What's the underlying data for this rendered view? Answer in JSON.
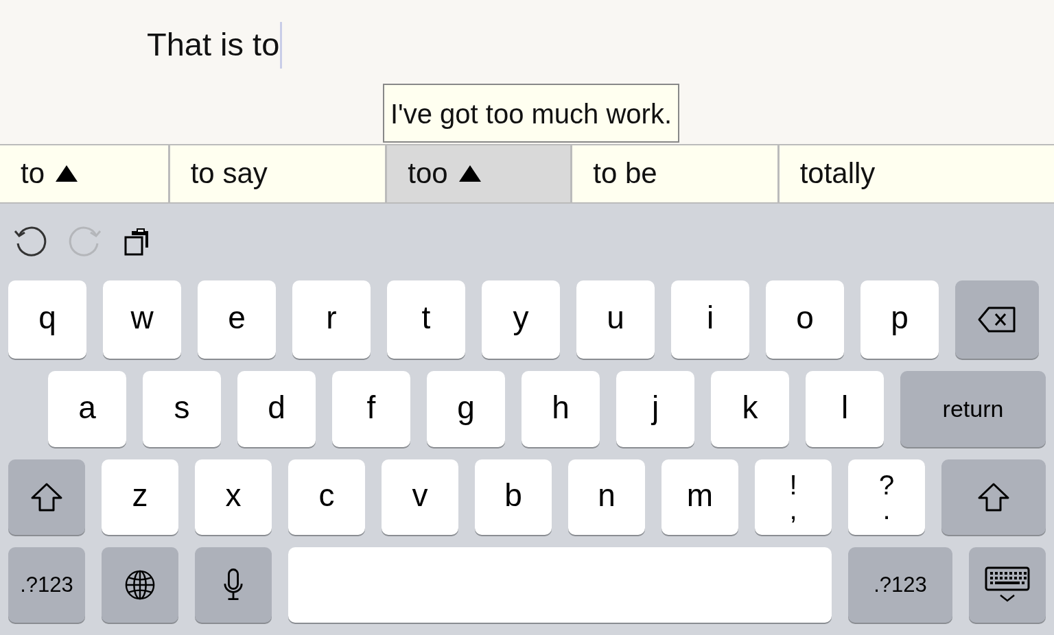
{
  "editor": {
    "text": "That is to"
  },
  "tooltip": {
    "text": "I've got too much work."
  },
  "candidates": [
    {
      "label": "to",
      "expandable": true,
      "selected": false
    },
    {
      "label": "to say",
      "expandable": false,
      "selected": false
    },
    {
      "label": "too",
      "expandable": true,
      "selected": true
    },
    {
      "label": "to be",
      "expandable": false,
      "selected": false
    },
    {
      "label": "totally",
      "expandable": false,
      "selected": false
    }
  ],
  "toolbar": [
    {
      "kind": "undo",
      "disabled": false
    },
    {
      "kind": "redo",
      "disabled": true
    },
    {
      "kind": "paste",
      "disabled": false
    }
  ],
  "keyboard": [
    [
      {
        "kind": "letter",
        "label": "q"
      },
      {
        "kind": "letter",
        "label": "w"
      },
      {
        "kind": "letter",
        "label": "e"
      },
      {
        "kind": "letter",
        "label": "r"
      },
      {
        "kind": "letter",
        "label": "t"
      },
      {
        "kind": "letter",
        "label": "y"
      },
      {
        "kind": "letter",
        "label": "u"
      },
      {
        "kind": "letter",
        "label": "i"
      },
      {
        "kind": "letter",
        "label": "o"
      },
      {
        "kind": "letter",
        "label": "p"
      },
      {
        "kind": "backspace"
      }
    ],
    [
      {
        "kind": "letter",
        "label": "a"
      },
      {
        "kind": "letter",
        "label": "s"
      },
      {
        "kind": "letter",
        "label": "d"
      },
      {
        "kind": "letter",
        "label": "f"
      },
      {
        "kind": "letter",
        "label": "g"
      },
      {
        "kind": "letter",
        "label": "h"
      },
      {
        "kind": "letter",
        "label": "j"
      },
      {
        "kind": "letter",
        "label": "k"
      },
      {
        "kind": "letter",
        "label": "l"
      },
      {
        "kind": "return",
        "label": "return"
      }
    ],
    [
      {
        "kind": "shift"
      },
      {
        "kind": "letter",
        "label": "z"
      },
      {
        "kind": "letter",
        "label": "x"
      },
      {
        "kind": "letter",
        "label": "c"
      },
      {
        "kind": "letter",
        "label": "v"
      },
      {
        "kind": "letter",
        "label": "b"
      },
      {
        "kind": "letter",
        "label": "n"
      },
      {
        "kind": "letter",
        "label": "m"
      },
      {
        "kind": "dual",
        "label": "!",
        "sub": ","
      },
      {
        "kind": "dual",
        "label": "?",
        "sub": "."
      },
      {
        "kind": "shift"
      }
    ],
    [
      {
        "kind": "mode",
        "label": ".?123"
      },
      {
        "kind": "globe"
      },
      {
        "kind": "mic"
      },
      {
        "kind": "space"
      },
      {
        "kind": "mode",
        "label": ".?123"
      },
      {
        "kind": "hide"
      }
    ]
  ]
}
